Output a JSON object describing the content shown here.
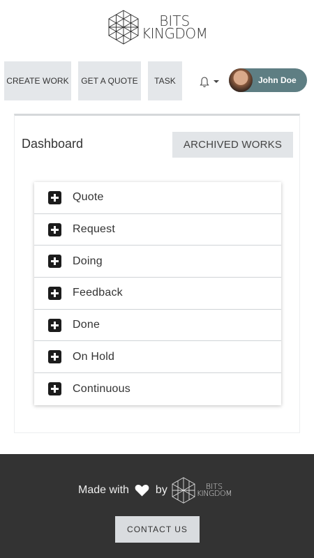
{
  "brand": {
    "line1": "BITS",
    "line2": "KINGDOM"
  },
  "nav": {
    "create_work": "CREATE WORK",
    "get_quote": "GET A QUOTE",
    "task": "TASK",
    "bell_icon": "bell-icon",
    "user_name": "John Doe"
  },
  "dashboard": {
    "title": "Dashboard",
    "archived_label": "ARCHIVED WORKS",
    "items": [
      {
        "label": "Quote"
      },
      {
        "label": "Request"
      },
      {
        "label": "Doing"
      },
      {
        "label": "Feedback"
      },
      {
        "label": "Done"
      },
      {
        "label": "On Hold"
      },
      {
        "label": "Continuous"
      }
    ]
  },
  "footer": {
    "made_with": "Made with",
    "by": "by",
    "contact_label": "CONTACT US"
  },
  "colors": {
    "user_pill": "#5e7e83",
    "footer_bg": "#333333",
    "button_bg": "#e4e7ea"
  }
}
